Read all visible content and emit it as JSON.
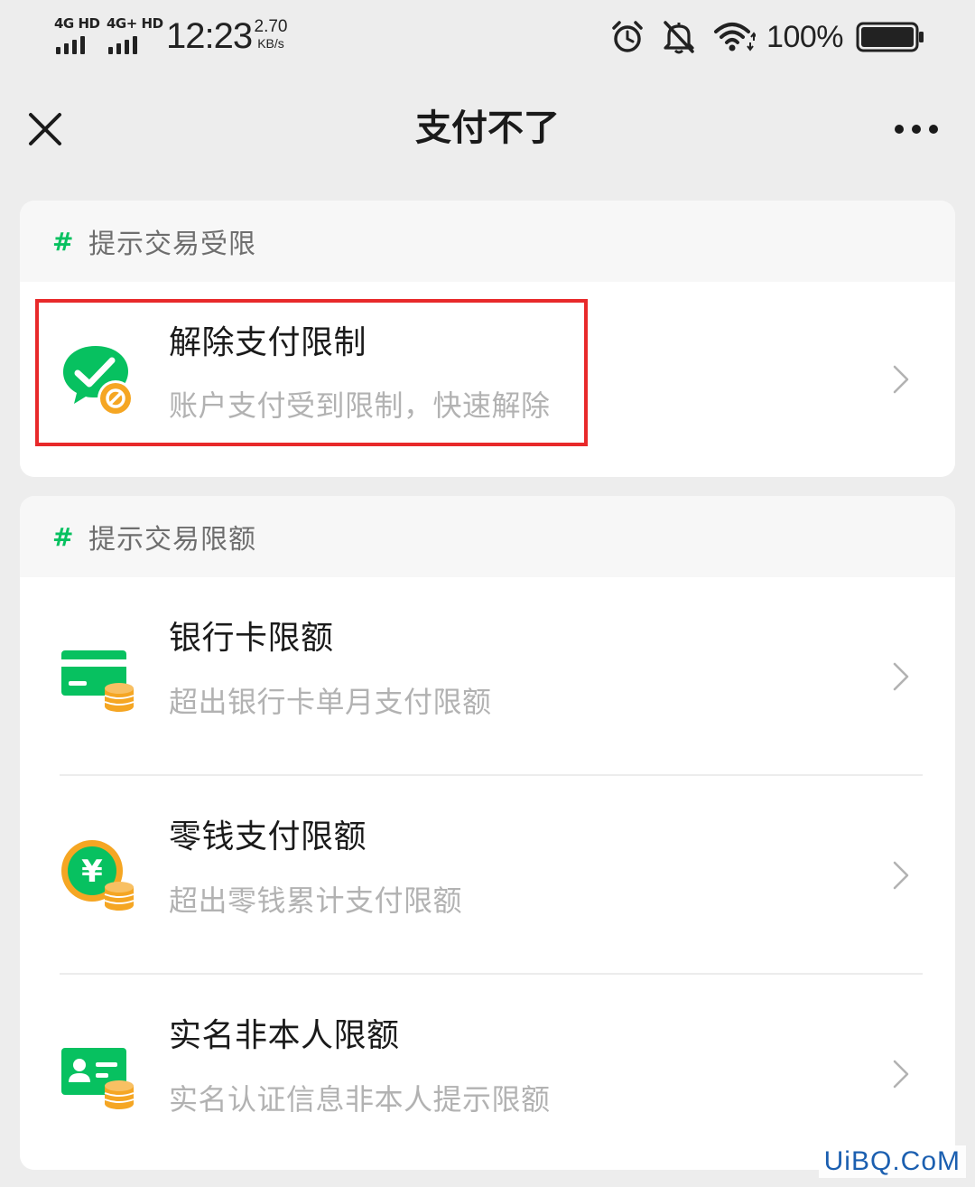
{
  "status_bar": {
    "network_1": "4G HD",
    "network_2": "4G+ HD",
    "time": "12:23",
    "net_speed_value": "2.70",
    "net_speed_unit": "KB/s",
    "battery_percent": "100%",
    "icons": [
      "alarm-icon",
      "mute-icon",
      "wifi-icon",
      "battery-icon"
    ]
  },
  "nav": {
    "title": "支付不了",
    "close_icon": "close-icon",
    "more_icon": "more-icon"
  },
  "sections": [
    {
      "header": "提示交易受限",
      "items": [
        {
          "title": "解除支付限制",
          "subtitle": "账户支付受到限制，快速解除",
          "icon": "wechat-pay-restricted-icon"
        }
      ]
    },
    {
      "header": "提示交易限额",
      "items": [
        {
          "title": "银行卡限额",
          "subtitle": "超出银行卡单月支付限额",
          "icon": "bank-card-icon"
        },
        {
          "title": "零钱支付限额",
          "subtitle": "超出零钱累计支付限额",
          "icon": "yuan-coin-icon"
        },
        {
          "title": "实名非本人限额",
          "subtitle": "实名认证信息非本人提示限额",
          "icon": "id-card-icon"
        }
      ]
    }
  ],
  "colors": {
    "accent_green": "#07c160",
    "coin_orange": "#f5a623",
    "highlight_red": "#e8292a",
    "background": "#ededed"
  },
  "watermark": "UiBQ.CoM"
}
